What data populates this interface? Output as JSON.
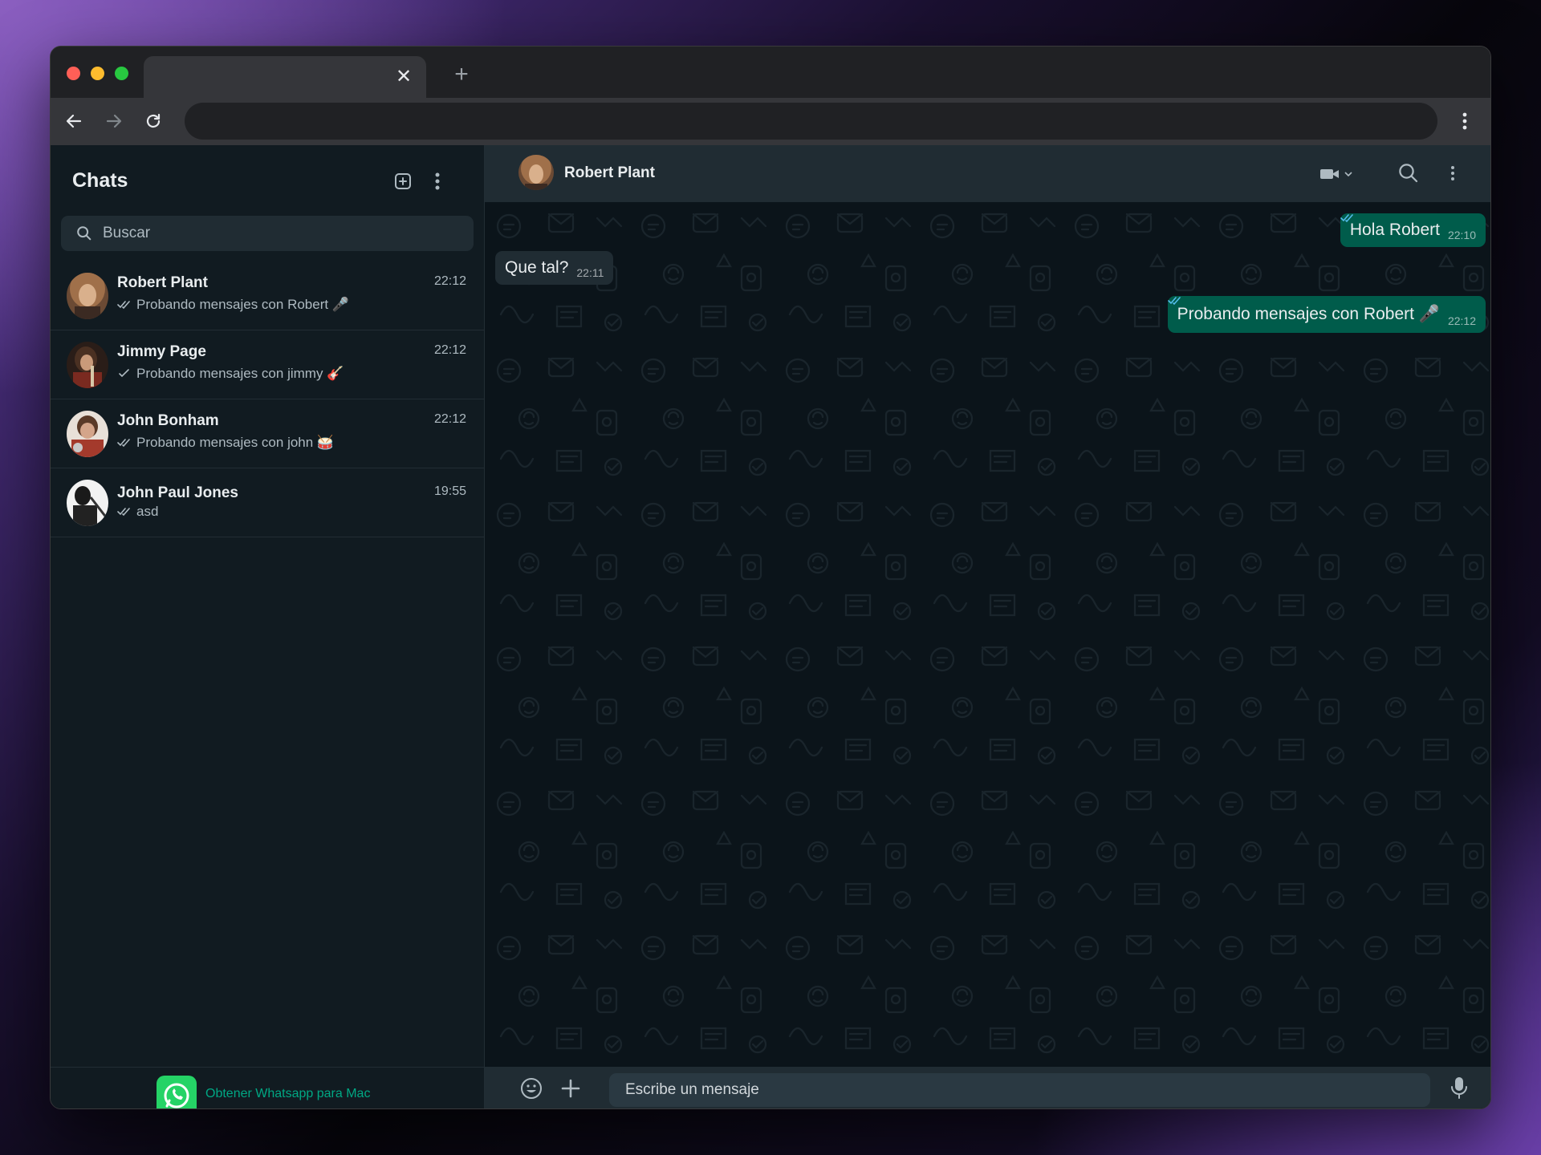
{
  "browser": {
    "tab_close_glyph": "✕",
    "new_tab_glyph": "+"
  },
  "sidebar": {
    "title": "Chats",
    "search_placeholder": "Buscar",
    "chats": [
      {
        "name": "Robert Plant",
        "time": "22:12",
        "preview": "Probando mensajes con Robert 🎤",
        "status": "read"
      },
      {
        "name": "Jimmy Page",
        "time": "22:12",
        "preview": "Probando mensajes con jimmy 🎸",
        "status": "sent"
      },
      {
        "name": "John Bonham",
        "time": "22:12",
        "preview": "Probando mensajes con john 🥁",
        "status": "read"
      },
      {
        "name": "John Paul Jones",
        "time": "19:55",
        "preview": "asd",
        "status": "read"
      }
    ],
    "footer_link": "Obtener Whatsapp para Mac"
  },
  "conversation": {
    "contact_name": "Robert Plant",
    "messages": [
      {
        "direction": "out",
        "text": "Hola Robert",
        "time": "22:10"
      },
      {
        "direction": "in",
        "text": "Que tal?",
        "time": "22:11"
      },
      {
        "direction": "out",
        "text": "Probando mensajes con Robert 🎤",
        "time": "22:12"
      }
    ],
    "composer_placeholder": "Escribe un mensaje"
  },
  "colors": {
    "accent": "#00a884",
    "outgoing_bubble": "#005c4b",
    "incoming_bubble": "#202c33",
    "read_tick": "#53bdeb",
    "panel": "#111b21",
    "header": "#202c33"
  }
}
